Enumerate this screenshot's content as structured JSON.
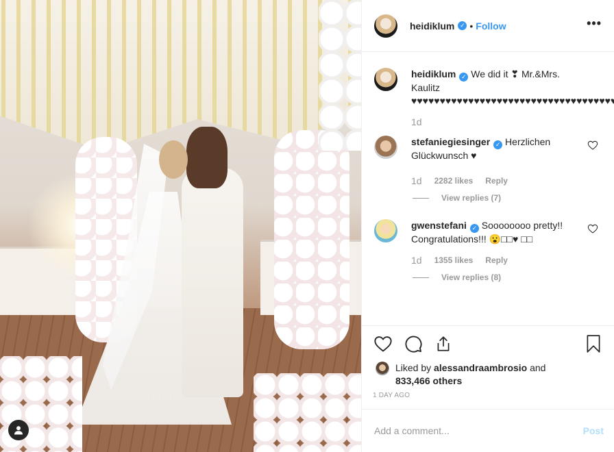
{
  "post": {
    "username": "heidiklum",
    "follow_label": "Follow",
    "dot": "•",
    "more_label": "•••"
  },
  "caption": {
    "username": "heidiklum",
    "text": "We did it ❣ Mr.&Mrs. Kaulitz ♥♥♥♥♥♥♥♥♥♥♥♥♥♥♥♥♥♥♥♥♥♥♥♥♥♥♥♥♥♥♥♥♥♥♥♥♥♥♥♥♥♥♥♥",
    "time": "1d"
  },
  "comments": [
    {
      "username": "stefaniegiesinger",
      "text": "Herzlichen Glückwunsch ♥",
      "time": "1d",
      "likes": "2282 likes",
      "reply": "Reply",
      "view_replies": "View replies (7)"
    },
    {
      "username": "gwenstefani",
      "text": "Soooooooo pretty!! Congratulations!!! 😮□□♥ □□",
      "time": "1d",
      "likes": "1355 likes",
      "reply": "Reply",
      "view_replies": "View replies (8)"
    }
  ],
  "likes_line": {
    "prefix": "Liked by ",
    "liker": "alessandraambrosio",
    "and": " and",
    "others": "833,466 others"
  },
  "timestamp": "1 DAY AGO",
  "add_comment": {
    "placeholder": "Add a comment...",
    "post_label": "Post"
  },
  "icons": {
    "like": "heart-icon",
    "comment": "comment-icon",
    "share": "share-icon",
    "save": "bookmark-icon",
    "photo_user": "user-icon"
  },
  "colors": {
    "accent": "#3897f0",
    "post_disabled": "#b2dffc",
    "muted": "#999999"
  }
}
